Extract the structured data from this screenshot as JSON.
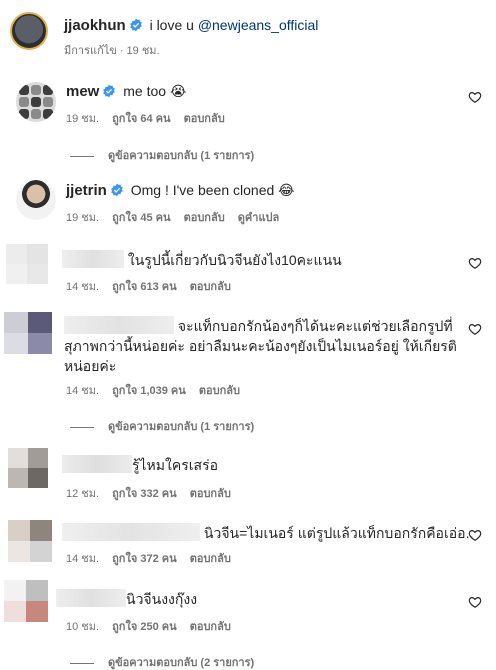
{
  "caption": {
    "username": "jjaokhun",
    "text": "i love u",
    "mention": "@newjeans_official",
    "edited": "มีการแก้ไข",
    "time": "19 ชม."
  },
  "labels": {
    "like": "ถูกใจ",
    "reply": "ตอบกลับ",
    "translate": "ดูคำแปล"
  },
  "comments": [
    {
      "username": "mew",
      "text": "me too 😭",
      "time": "19 ชม.",
      "likes": "ถูกใจ 64 คน",
      "replies_label": "ดูข้อความตอบกลับ (1 รายการ)"
    },
    {
      "username": "jjetrin",
      "text": "Omg ! I've been cloned 😂",
      "time": "19 ชม.",
      "likes": "ถูกใจ 45 คน"
    },
    {
      "text": "ในรูปนี้เกี่ยวกับนิวจีนยังไง10คะแนน",
      "time": "14 ชม.",
      "likes": "ถูกใจ 613 คน"
    },
    {
      "text_line1": "จะแท็กบอกรักน้องๆก็ได้นะคะแต่ช่วยเลือกรูปที่",
      "text_line2": "สุภาพกว่านี้หน่อยค่ะ อย่าลืมนะคะน้องๆยังเป็นไมเนอร์อยู่ ให้เกียรติ",
      "text_line3": "หน่อยค่ะ",
      "time": "14 ชม.",
      "likes": "ถูกใจ 1,039 คน",
      "replies_label": "ดูข้อความตอบกลับ (1 รายการ)"
    },
    {
      "text": "รู้ไหมใครเสร่อ",
      "time": "12 ชม.",
      "likes": "ถูกใจ 332 คน"
    },
    {
      "text": "นิวจีน=ไมเนอร์ แต่รูปแล้วแท็กบอกรักคือเอ่อ..",
      "time": "14 ชม.",
      "likes": "ถูกใจ 372 คน"
    },
    {
      "text": "นิวจีนงงกุ๊งง",
      "time": "10 ชม.",
      "likes": "ถูกใจ 250 คน",
      "replies_label": "ดูข้อความตอบกลับ (2 รายการ)"
    }
  ],
  "colors": {
    "verified": "#3897f0",
    "meta": "#737373",
    "mention": "#00376b"
  }
}
